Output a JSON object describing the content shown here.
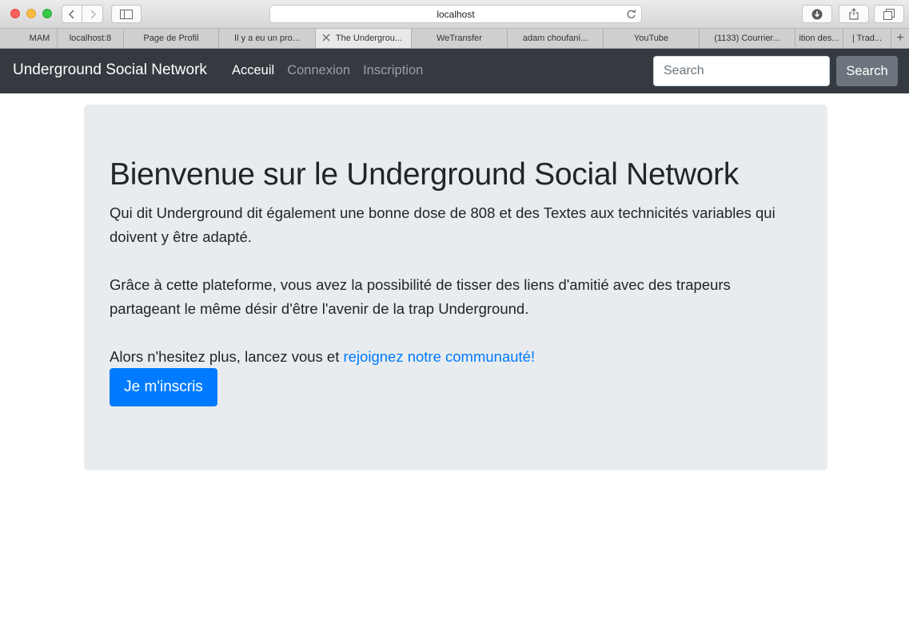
{
  "browser": {
    "url": "localhost",
    "tabs": [
      {
        "label": "MAM",
        "active": false
      },
      {
        "label": "localhost:8",
        "active": false
      },
      {
        "label": "Page de Profil",
        "active": false
      },
      {
        "label": "Il y a eu un pro...",
        "active": false
      },
      {
        "label": "The Undergrou...",
        "active": true
      },
      {
        "label": "WeTransfer",
        "active": false
      },
      {
        "label": "adam choufani...",
        "active": false
      },
      {
        "label": "YouTube",
        "active": false
      },
      {
        "label": "(1133) Courrier...",
        "active": false
      },
      {
        "label": "ition des...",
        "active": false
      },
      {
        "label": "| Trad...",
        "active": false
      }
    ]
  },
  "navbar": {
    "brand": "Underground Social Network",
    "links": [
      {
        "label": "Acceuil",
        "active": true
      },
      {
        "label": "Connexion",
        "active": false
      },
      {
        "label": "Inscription",
        "active": false
      }
    ],
    "search_placeholder": "Search",
    "search_button": "Search"
  },
  "jumbotron": {
    "title": "Bienvenue sur le Underground Social Network",
    "paragraph1": "Qui dit Underground dit également une bonne dose de 808 et des Textes aux technicités variables qui doivent y être adapté.",
    "paragraph2": "Grâce à cette plateforme, vous avez la possibilité de tisser des liens d'amitié avec des trapeurs partageant le même désir d'être l'avenir de la trap Underground.",
    "paragraph3_text": "Alors n'hesitez plus, lancez vous et ",
    "paragraph3_link": "rejoignez notre communauté!",
    "cta_button": "Je m'inscris"
  },
  "colors": {
    "navbar_bg": "#343a40",
    "jumbotron_bg": "#e9ecef",
    "primary": "#007bff",
    "secondary": "#6c757d"
  }
}
